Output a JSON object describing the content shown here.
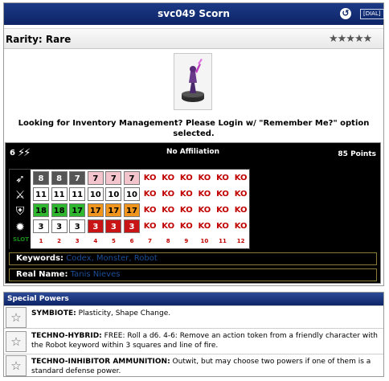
{
  "title": "svc049 Scorn",
  "header_buttons": {
    "dial": "[DIAL]",
    "back_icon": "refresh-icon"
  },
  "rarity": {
    "label": "Rarity: Rare",
    "stars_glyph": "★★★★★",
    "star_count": 5
  },
  "notice": "Looking for Inventory Management? Please Login w/ \"Remember Me?\" option selected.",
  "dial": {
    "range": "6",
    "range_icon": "triple-lightning-icon",
    "affiliation": "No Affiliation",
    "points": "85 Points",
    "stat_icons": [
      "speed-wing-icon",
      "attack-icon",
      "defense-icon",
      "damage-icon"
    ],
    "slot_label": "SLOT",
    "slots": [
      "1",
      "2",
      "3",
      "4",
      "5",
      "6",
      "7",
      "8",
      "9",
      "10",
      "11",
      "12"
    ],
    "rows": [
      [
        "8",
        "8",
        "7",
        "7",
        "7",
        "7",
        "KO",
        "KO",
        "KO",
        "KO",
        "KO",
        "KO"
      ],
      [
        "11",
        "11",
        "11",
        "10",
        "10",
        "10",
        "KO",
        "KO",
        "KO",
        "KO",
        "KO",
        "KO"
      ],
      [
        "18",
        "18",
        "17",
        "17",
        "17",
        "17",
        "KO",
        "KO",
        "KO",
        "KO",
        "KO",
        "KO"
      ],
      [
        "3",
        "3",
        "3",
        "3",
        "3",
        "3",
        "KO",
        "KO",
        "KO",
        "KO",
        "KO",
        "KO"
      ]
    ],
    "colors": {
      "speed": [
        "#555555",
        "#555555",
        "#555555",
        "#f4c4cc",
        "#f4c4cc",
        "#f4c4cc"
      ],
      "attack": [
        "#ffffff",
        "#ffffff",
        "#ffffff",
        "#ffffff",
        "#ffffff",
        "#ffffff"
      ],
      "defense": [
        "#2fb82f",
        "#2fb82f",
        "#2fb82f",
        "#f0961e",
        "#f0961e",
        "#f0961e"
      ],
      "damage": [
        "#ffffff",
        "#ffffff",
        "#ffffff",
        "#c81414",
        "#c81414",
        "#c81414"
      ]
    },
    "text_colors": {
      "speed": [
        "#ffffff",
        "#ffffff",
        "#ffffff",
        "#000000",
        "#000000",
        "#000000"
      ],
      "attack": [
        "#000000",
        "#000000",
        "#000000",
        "#000000",
        "#000000",
        "#000000"
      ],
      "defense": [
        "#000000",
        "#000000",
        "#000000",
        "#000000",
        "#000000",
        "#000000"
      ],
      "damage": [
        "#000000",
        "#000000",
        "#000000",
        "#ffffff",
        "#ffffff",
        "#ffffff"
      ]
    }
  },
  "keywords": {
    "label": "Keywords:",
    "items": [
      "Codex",
      "Monster",
      "Robot"
    ]
  },
  "real_name": {
    "label": "Real Name:",
    "value": "Tanis Nieves"
  },
  "special_powers": {
    "heading": "Special Powers",
    "items": [
      {
        "name": "SYMBIOTE:",
        "text": "Plasticity, Shape Change.",
        "icon": "star-outline-icon"
      },
      {
        "name": "TECHNO-HYBRID:",
        "text": "FREE: Roll a d6. 4-6: Remove an action token from a friendly character with the Robot keyword within 3 squares and line of fire.",
        "icon": "star-outline-icon"
      },
      {
        "name": "TECHNO-INHIBITOR AMMUNITION:",
        "text": "Outwit, but may choose two powers if one of them is a standard defense power.",
        "icon": "star-outline-icon"
      }
    ]
  }
}
